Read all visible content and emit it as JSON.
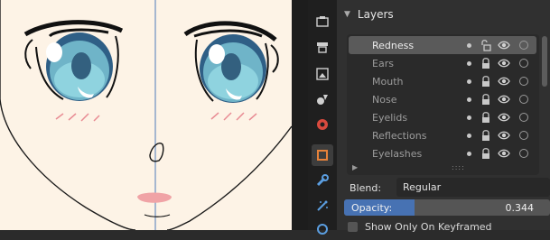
{
  "panel": {
    "title": "Layers"
  },
  "layers": [
    {
      "name": "Redness",
      "active": true,
      "locked": false
    },
    {
      "name": "Ears",
      "active": false,
      "locked": true
    },
    {
      "name": "Mouth",
      "active": false,
      "locked": true
    },
    {
      "name": "Nose",
      "active": false,
      "locked": true
    },
    {
      "name": "Eyelids",
      "active": false,
      "locked": true
    },
    {
      "name": "Reflections",
      "active": false,
      "locked": true
    },
    {
      "name": "Eyelashes",
      "active": false,
      "locked": true
    }
  ],
  "blend": {
    "label": "Blend:",
    "value": "Regular"
  },
  "opacity": {
    "label": "Opacity:",
    "value": "0.344",
    "fraction": 0.344
  },
  "keyframed": {
    "label": "Show Only On Keyframed"
  },
  "colors": {
    "accent": "#4772b3",
    "active_row": "#5a5a5a",
    "canvas": "#fdf3e6"
  },
  "toolstrip": [
    "tool-icon",
    "render-icon",
    "output-icon",
    "view-layer-icon",
    "scene-icon",
    "object-icon",
    "modifier-icon",
    "particles-icon",
    "physics-icon"
  ]
}
